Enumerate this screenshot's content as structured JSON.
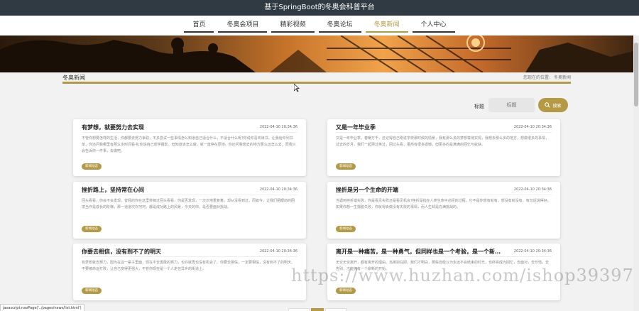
{
  "app_title": "基于SpringBoot的冬奥会科普平台",
  "nav": [
    {
      "label": "首页",
      "active": false
    },
    {
      "label": "冬奥会项目",
      "active": false
    },
    {
      "label": "精彩视频",
      "active": false
    },
    {
      "label": "冬奥论坛",
      "active": false
    },
    {
      "label": "冬奥新闻",
      "active": true
    },
    {
      "label": "个人中心",
      "active": false
    }
  ],
  "section": {
    "title": "冬奥新闻",
    "crumb_prefix": "您现在的位置:",
    "crumb_current": "冬奥新闻"
  },
  "search": {
    "label": "标题",
    "placeholder": "标题",
    "button": "搜索"
  },
  "news": [
    {
      "title": "有梦想，就要努力去实现",
      "date": "2022-04-10 20:34:36",
      "body": "不管你想要怎样的生活，你都要去努力争取，不多尝试一些事情怎么知道自己适合什么，不适合什么呢?你说你喜欢读书，让我给你列书单，你还问我哪里有那么多时间看书;你说自己想学摄影，但知道该怎么做，就一直停在原地。你还问我想去的地方那么远怎么去，而我只会告诉你一件事，去做吧。",
      "tag": "新闻动态"
    },
    {
      "title": "又是一年毕业季",
      "date": "2022-04-10 20:34:36",
      "body": "又是一年毕业季，春暖万千，还记得自己刚进学校那时候的情景，我有那么多的梦想等待实现，我想去那么多的地方，想做很多的事情，过去的岁月，我们一起哭过笑过，回过头看，虽然有很多遗憾，但更多的是满满的回忆与收获。",
      "tag": "新闻动态"
    },
    {
      "title": "挫折路上，坚持常在心间",
      "date": "2022-04-10 20:34:36",
      "body": "回头看看，你会不会发现，曾经的你在这里徘徊过回头看看，你是否发现，一次次地重复着，却从没看到过，而如今，让我们把眼前的困境当作是成长的阶梯，那一道道坎坎坷坷，都是成功路上的风景，今天的你，是否要面对挑战。",
      "tag": "新闻动态"
    },
    {
      "title": "挫折是另一个生命的开端",
      "date": "2022-04-10 20:34:36",
      "body": "当遇到挫折或失败，你是看见失败还是看见机会?挫折是指在人类生命中必经的过程，它不是你想有就有，想没有就没有，有句话说得好，如果你想一生摆脱失败，你就得去做没有失败的事情，而人生却是充满挑战的。",
      "tag": "新闻动态"
    },
    {
      "title": "你要去相信，没有到不了的明天",
      "date": "2022-04-10 20:34:36",
      "body": "有梦想就去努力，因为在这一辈子里面，现在不去勇敢的努力，也许就再也没有机会了。你要去相信，一定要相信，没有到不了的明天。不要被命运打败，让自己变得更强大，不管你现在是一个人走在异乡的街道上。",
      "tag": "新闻动态"
    },
    {
      "title": "离开是一种痛苦，是一种勇气，但同样也是一个考验，是一个新的开始",
      "date": "2022-04-10 20:34:36",
      "body": "无论无论离开，都有离开的理由。当离别在即，我们才明白，那些曾经以为永远不会结束的时光，也终将成为回忆，去面对，去珍惜，去告别，才能拥有一个崭新的开始。",
      "tag": "新闻动态"
    }
  ],
  "status_link": "javascript:navPage('../pages/news/list.html')",
  "watermark": "https://www.huzhan.com/ishop39397"
}
